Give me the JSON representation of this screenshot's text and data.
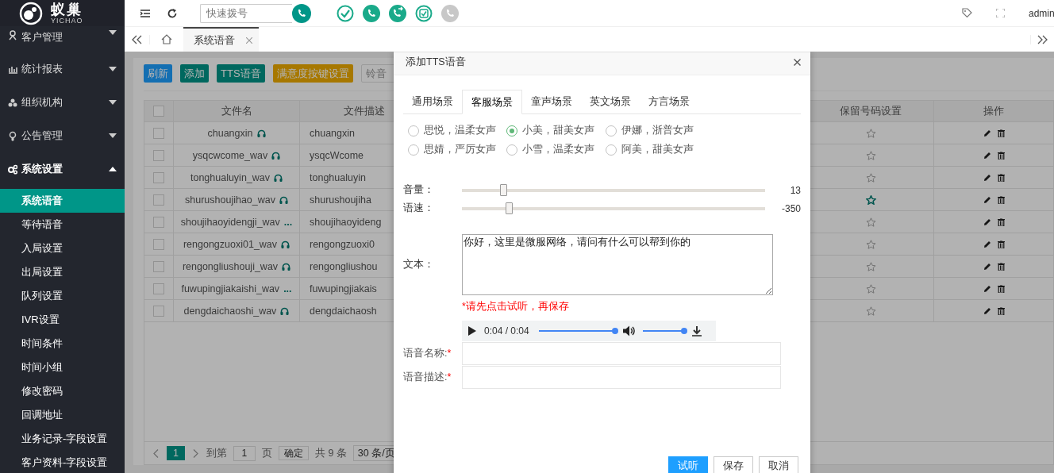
{
  "logo": {
    "name": "蚁巢",
    "subtitle": "YICHAO"
  },
  "sidebar": {
    "groups": [
      {
        "label": "客户管理",
        "expanded": false
      },
      {
        "label": "统计报表",
        "expanded": false
      },
      {
        "label": "组织机构",
        "expanded": false
      },
      {
        "label": "公告管理",
        "expanded": false
      },
      {
        "label": "系统设置",
        "expanded": true,
        "children": [
          {
            "label": "系统语音",
            "selected": true
          },
          {
            "label": "等待语音",
            "selected": false
          },
          {
            "label": "入局设置",
            "selected": false
          },
          {
            "label": "出局设置",
            "selected": false
          },
          {
            "label": "队列设置",
            "selected": false
          },
          {
            "label": "IVR设置",
            "selected": false
          },
          {
            "label": "时间条件",
            "selected": false
          },
          {
            "label": "时间小组",
            "selected": false
          },
          {
            "label": "修改密码",
            "selected": false
          },
          {
            "label": "回调地址",
            "selected": false
          },
          {
            "label": "业务记录-字段设置",
            "selected": false
          },
          {
            "label": "客户资料-字段设置",
            "selected": false
          }
        ]
      }
    ]
  },
  "topbar": {
    "search": {
      "placeholder": "快速拨号"
    },
    "status_icons": [
      {
        "kind": "check",
        "disabled": false
      },
      {
        "kind": "phone",
        "disabled": false
      },
      {
        "kind": "transfer",
        "disabled": false
      },
      {
        "kind": "badge",
        "disabled": false
      },
      {
        "kind": "phone",
        "disabled": true
      }
    ],
    "user": "admin"
  },
  "tabbar": {
    "tabs": [
      {
        "label": "系统语音",
        "selected": true
      }
    ]
  },
  "toolbar": {
    "buttons": [
      {
        "label": "刷新",
        "kind": "blue"
      },
      {
        "label": "添加",
        "kind": "teal"
      },
      {
        "label": "TTS语音",
        "kind": "teal"
      },
      {
        "label": "满意度按键设置",
        "kind": "gold"
      },
      {
        "label": "铃音",
        "kind": "outline"
      }
    ]
  },
  "table": {
    "select_all_checked": false,
    "columns": [
      "文件名",
      "文件描述",
      "保留号码设置",
      "操作"
    ],
    "rows": [
      {
        "checked": false,
        "file_name": "chuangxin",
        "marker": {
          "kind": "headphones"
        },
        "description": "chuangxin",
        "starred": false
      },
      {
        "checked": false,
        "file_name": "ysqcwcome_wav",
        "marker": {
          "kind": "headphones"
        },
        "description": "ysqcWcome",
        "starred": false
      },
      {
        "checked": false,
        "file_name": "tonghualuyin_wav",
        "marker": {
          "kind": "headphones"
        },
        "description": "tonghualuyin",
        "starred": false
      },
      {
        "checked": false,
        "file_name": "shurushoujihao_wav",
        "marker": {
          "kind": "headphones"
        },
        "description": "shurushoujiha",
        "starred": true
      },
      {
        "checked": false,
        "file_name": "shoujihaoyidengji_wav",
        "marker": {
          "kind": "text",
          "text": "..."
        },
        "description": "shoujihaoyideng",
        "starred": false
      },
      {
        "checked": false,
        "file_name": "rengongzuoxi01_wav",
        "marker": {
          "kind": "headphones"
        },
        "description": "rengongzuoxi0",
        "starred": false
      },
      {
        "checked": false,
        "file_name": "rengongliushouji_wav",
        "marker": {
          "kind": "headphones"
        },
        "description": "rengongliushou",
        "starred": false
      },
      {
        "checked": false,
        "file_name": "fuwupingjiakaishi_wav",
        "marker": {
          "kind": "text",
          "text": "..."
        },
        "description": "fuwupingjiakais",
        "starred": false
      },
      {
        "checked": false,
        "file_name": "dengdaichaoshi_wav",
        "marker": {
          "kind": "headphones"
        },
        "description": "dengdaichaosh",
        "starred": false
      }
    ]
  },
  "pagination": {
    "current": "1",
    "goto_label": "到第",
    "goto_value": "1",
    "page_unit": "页",
    "confirm": "确定",
    "total": "共 9 条",
    "page_size": "30 条/页"
  },
  "dialog": {
    "title": "添加TTS语音",
    "tabs": [
      {
        "label": "通用场景",
        "selected": false
      },
      {
        "label": "客服场景",
        "selected": true
      },
      {
        "label": "童声场景",
        "selected": false
      },
      {
        "label": "英文场景",
        "selected": false
      },
      {
        "label": "方言场景",
        "selected": false
      }
    ],
    "voices": [
      {
        "label": "思悦，温柔女声",
        "selected": false
      },
      {
        "label": "小美，甜美女声",
        "selected": true
      },
      {
        "label": "伊娜，浙普女声",
        "selected": false
      },
      {
        "label": "思婧，严厉女声",
        "selected": false
      },
      {
        "label": "小雪，温柔女声",
        "selected": false
      },
      {
        "label": "阿美，甜美女声",
        "selected": false
      }
    ],
    "sliders": [
      {
        "label": "音量：",
        "level": 0.136,
        "reading": "13"
      },
      {
        "label": "语速：",
        "level": 0.155,
        "reading": "-350"
      }
    ],
    "text": {
      "label": "文本：",
      "value": "你好，这里是微服网络，请问有什么可以帮到你的"
    },
    "warning": "*请先点击试听，再保存",
    "audio": {
      "time": "0:04 / 0:04",
      "level": 1,
      "volume": {
        "level": 1
      }
    },
    "fields": [
      {
        "label": "语音名称:",
        "required_mark": "*"
      },
      {
        "label": "语音描述:",
        "required_mark": "*"
      }
    ],
    "buttons": [
      {
        "label": "试听",
        "kind": "primary"
      },
      {
        "label": "保存",
        "kind": "default"
      },
      {
        "label": "取消",
        "kind": "default"
      }
    ]
  }
}
